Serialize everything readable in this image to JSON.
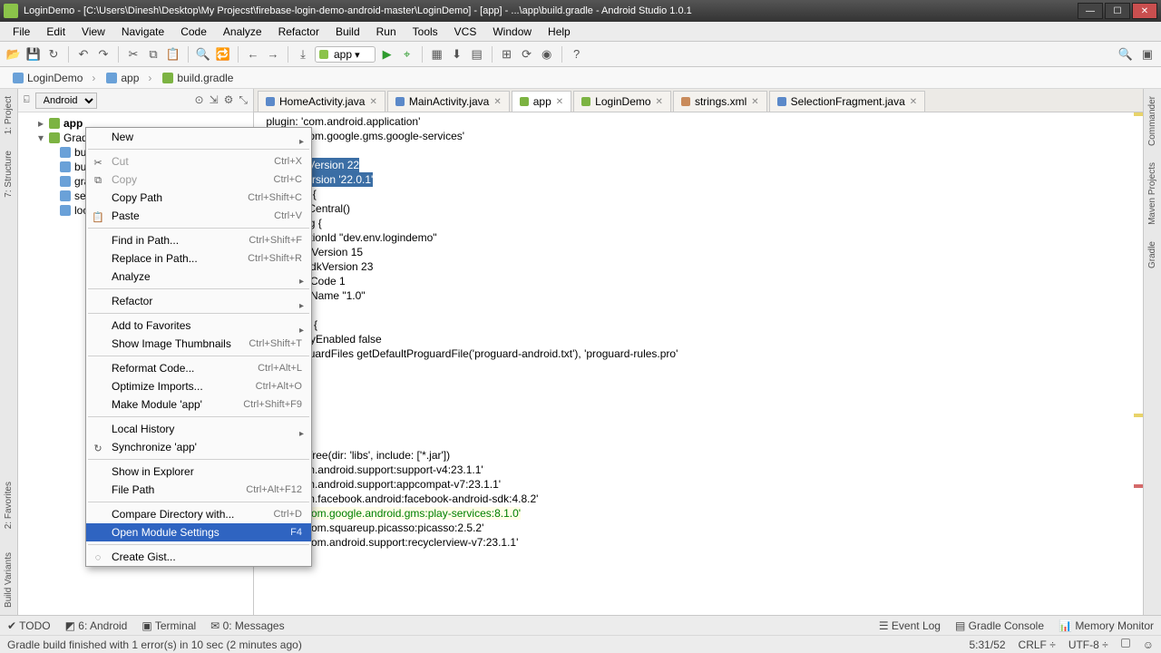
{
  "window": {
    "title": "LoginDemo - [C:\\Users\\Dinesh\\Desktop\\My Projecst\\firebase-login-demo-android-master\\LoginDemo] - [app] - ...\\app\\build.gradle - Android Studio 1.0.1"
  },
  "menubar": [
    "File",
    "Edit",
    "View",
    "Navigate",
    "Code",
    "Analyze",
    "Refactor",
    "Build",
    "Run",
    "Tools",
    "VCS",
    "Window",
    "Help"
  ],
  "run_config": "app",
  "breadcrumb": {
    "project": "LoginDemo",
    "module": "app",
    "file": "build.gradle"
  },
  "project_view": {
    "mode": "Android",
    "nodes": {
      "app": "app",
      "gradle": "Gradle",
      "bu1": "bu",
      "bu2": "bu",
      "gra": "gra",
      "set": "set",
      "loc": "loc"
    }
  },
  "tabs": [
    {
      "label": "HomeActivity.java",
      "type": "java"
    },
    {
      "label": "MainActivity.java",
      "type": "java"
    },
    {
      "label": "app",
      "type": "gradle",
      "active": true
    },
    {
      "label": "LoginDemo",
      "type": "gradle"
    },
    {
      "label": "strings.xml",
      "type": "xml"
    },
    {
      "label": "SelectionFragment.java",
      "type": "java"
    }
  ],
  "code": {
    "l1": " plugin: 'com.android.application'",
    "l2": " plugin: 'com.google.gms.google-services'",
    "l3": "d {",
    "l4": "mpileSdkVersion 22",
    "l5": "ildToolsVersion '22.0.1'",
    "l6": "positories {",
    "l7": "    mavenCentral()",
    "l8": "",
    "l9": "faultConfig {",
    "l10": "    applicationId \"dev.env.logindemo\"",
    "l11": "    minSdkVersion 15",
    "l12": "    targetSdkVersion 23",
    "l13": "    versionCode 1",
    "l14": "    versionName \"1.0\"",
    "l15": "",
    "l16": "ildTypes {",
    "l17": "    release {",
    "l18": "        minifyEnabled false",
    "l19": "        proguardFiles getDefaultProguardFile('proguard-android.txt'), 'proguard-rules.pro'",
    "l20": "    }",
    "l21": "",
    "l22": "",
    "l23": "encies {",
    "l24": "mpile fileTree(dir: 'libs', include: ['*.jar'])",
    "l25": "mpile 'com.android.support:support-v4:23.1.1'",
    "l26": "mpile 'com.android.support:appcompat-v7:23.1.1'",
    "l27": "mpile 'com.facebook.android:facebook-android-sdk:4.8.2'",
    "l28_a": "compile ",
    "l28_b": "'com.google.android.gms:play-services:8.1.0'",
    "l29": "compile 'com.squareup.picasso:picasso:2.5.2'",
    "l30": "compile 'com.android.support:recyclerview-v7:23.1.1'"
  },
  "context_menu": [
    {
      "label": "New",
      "submenu": true
    },
    {
      "sep": true
    },
    {
      "label": "Cut",
      "shortcut": "Ctrl+X",
      "disabled": true,
      "icon": "✂"
    },
    {
      "label": "Copy",
      "shortcut": "Ctrl+C",
      "disabled": true,
      "icon": "⧉"
    },
    {
      "label": "Copy Path",
      "shortcut": "Ctrl+Shift+C"
    },
    {
      "label": "Paste",
      "shortcut": "Ctrl+V",
      "icon": "📋"
    },
    {
      "sep": true
    },
    {
      "label": "Find in Path...",
      "shortcut": "Ctrl+Shift+F"
    },
    {
      "label": "Replace in Path...",
      "shortcut": "Ctrl+Shift+R"
    },
    {
      "label": "Analyze",
      "submenu": true
    },
    {
      "sep": true
    },
    {
      "label": "Refactor",
      "submenu": true
    },
    {
      "sep": true
    },
    {
      "label": "Add to Favorites",
      "submenu": true
    },
    {
      "label": "Show Image Thumbnails",
      "shortcut": "Ctrl+Shift+T"
    },
    {
      "sep": true
    },
    {
      "label": "Reformat Code...",
      "shortcut": "Ctrl+Alt+L"
    },
    {
      "label": "Optimize Imports...",
      "shortcut": "Ctrl+Alt+O"
    },
    {
      "label": "Make Module 'app'",
      "shortcut": "Ctrl+Shift+F9"
    },
    {
      "sep": true
    },
    {
      "label": "Local History",
      "submenu": true
    },
    {
      "label": "Synchronize 'app'",
      "icon": "↻"
    },
    {
      "sep": true
    },
    {
      "label": "Show in Explorer"
    },
    {
      "label": "File Path",
      "shortcut": "Ctrl+Alt+F12"
    },
    {
      "sep": true
    },
    {
      "label": "Compare Directory with...",
      "shortcut": "Ctrl+D"
    },
    {
      "label": "Open Module Settings",
      "shortcut": "F4",
      "selected": true
    },
    {
      "sep": true
    },
    {
      "label": "Create Gist...",
      "icon": "◌"
    }
  ],
  "left_tool_tabs": [
    "1: Project",
    "7: Structure"
  ],
  "left_bottom_tabs": [
    "2: Favorites",
    "Build Variants"
  ],
  "right_tool_tabs": [
    "Commander",
    "Maven Projects",
    "Gradle"
  ],
  "bottom_tabs": {
    "todo": "TODO",
    "android": "6: Android",
    "terminal": "Terminal",
    "messages": "0: Messages",
    "eventlog": "Event Log",
    "gradleconsole": "Gradle Console",
    "memmon": "Memory Monitor"
  },
  "status": {
    "msg": "Gradle build finished with 1 error(s) in 10 sec (2 minutes ago)",
    "pos": "5:31/52",
    "sep": "CRLF ÷",
    "enc": "UTF-8 ÷"
  }
}
